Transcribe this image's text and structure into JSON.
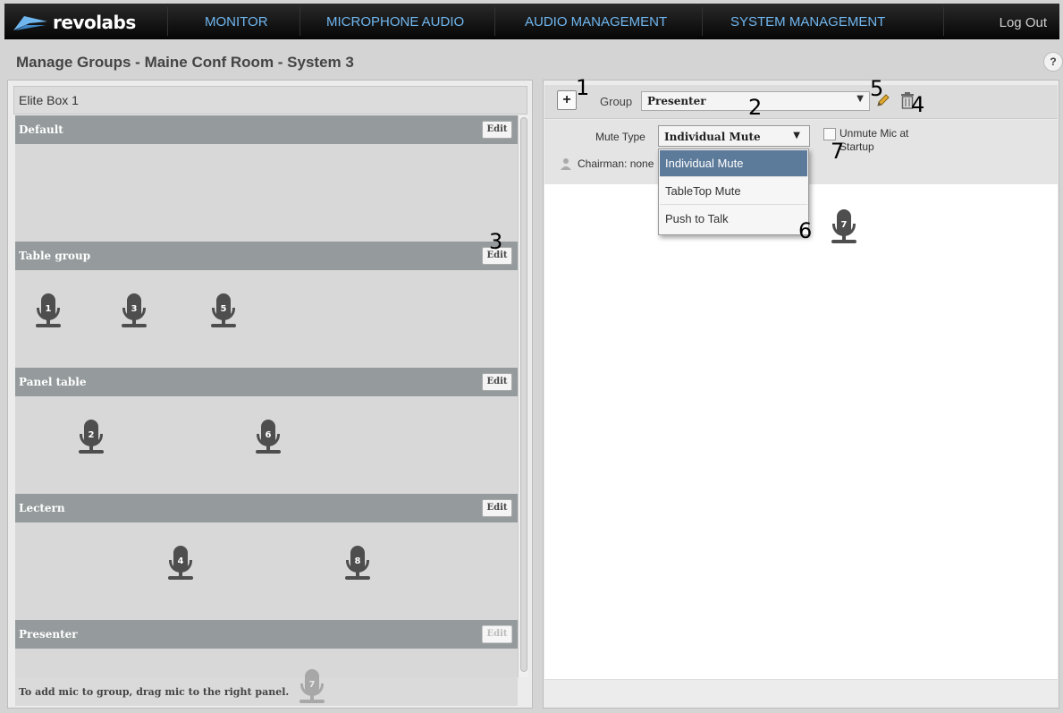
{
  "nav": {
    "brand": "revolabs",
    "items": [
      "MONITOR",
      "MICROPHONE AUDIO",
      "AUDIO MANAGEMENT",
      "SYSTEM MANAGEMENT"
    ],
    "logout": "Log Out",
    "link_color": "#6fb6ef"
  },
  "page": {
    "title": "Manage Groups - Maine Conf Room - System 3",
    "help": "?"
  },
  "left": {
    "title": "Elite Box 1",
    "edit_label": "Edit",
    "groups": [
      {
        "name": "Default",
        "mics": [],
        "edit_enabled": true
      },
      {
        "name": "Table group",
        "mics": [
          "1",
          "3",
          "5"
        ],
        "edit_enabled": true
      },
      {
        "name": "Panel table",
        "mics": [
          "2",
          "6"
        ],
        "edit_enabled": true
      },
      {
        "name": "Lectern",
        "mics": [
          "4",
          "8"
        ],
        "edit_enabled": true
      },
      {
        "name": "Presenter",
        "mics": [],
        "edit_enabled": false
      }
    ],
    "footer_note": "To add mic to group, drag mic to the right panel.",
    "dragging_mic": "7"
  },
  "right": {
    "add_label": "+",
    "group_label": "Group",
    "group_value": "Presenter",
    "mute_type_label": "Mute Type",
    "mute_type_value": "Individual Mute",
    "mute_options": [
      "Individual Mute",
      "TableTop Mute",
      "Push to Talk"
    ],
    "unmute_label": "Unmute Mic at Startup",
    "unmute_checked": false,
    "chairman_label": "Chairman: none",
    "mics": [
      "7"
    ]
  },
  "annotations": [
    "1",
    "2",
    "3",
    "4",
    "5",
    "6",
    "7"
  ]
}
